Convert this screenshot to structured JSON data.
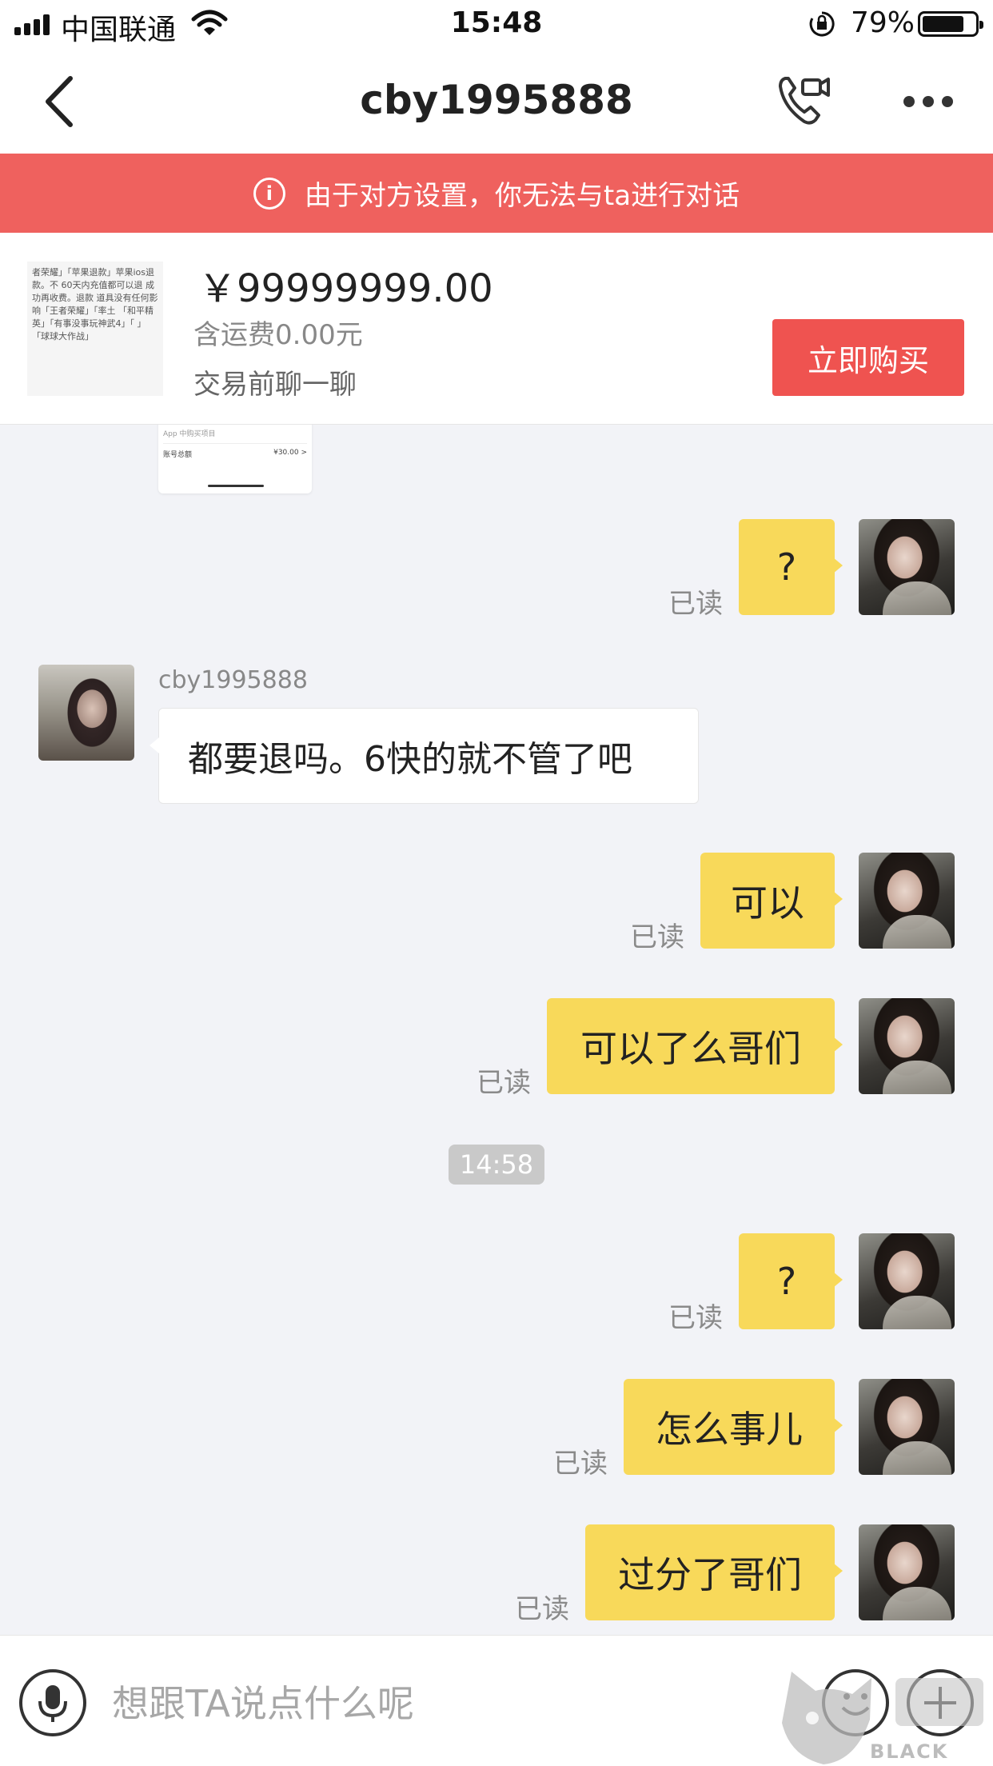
{
  "status_bar": {
    "carrier": "中国联通",
    "time": "15:48",
    "battery_percent": "79%",
    "battery_level": 0.79
  },
  "header": {
    "title": "cby1995888",
    "back_icon": "chevron-left-icon",
    "call_icon": "phone-video-icon",
    "more_icon": "more-dots-icon"
  },
  "banner": {
    "text": "由于对方设置，你无法与ta进行对话",
    "color": "#ef615e"
  },
  "product": {
    "thumb_text": "者荣耀」「苹果退款」苹果ios退款。不 60天内充值都可以退 成功再收费。退款 道具没有任何影响「王者荣耀」「率土 「和平精英」「有事没事玩神武4」「 」「球球大作战」",
    "price": "￥99999999.00",
    "shipping": "含运费0.00元",
    "hint": "交易前聊一聊",
    "buy_label": "立即购买",
    "buy_color": "#ef5350"
  },
  "partial_card": {
    "line1": "App 中购买项目",
    "label": "账号总额",
    "amount": "¥30.00 >"
  },
  "messages": {
    "m1": {
      "text": "?",
      "status": "已读"
    },
    "m2": {
      "sender": "cby1995888",
      "text": "都要退吗。6快的就不管了吧"
    },
    "m3": {
      "text": "可以",
      "status": "已读"
    },
    "m4": {
      "text": "可以了么哥们",
      "status": "已读"
    },
    "timestamp": "14:58",
    "m5": {
      "text": "?",
      "status": "已读"
    },
    "m6": {
      "text": "怎么事儿",
      "status": "已读"
    },
    "m7": {
      "text": "过分了哥们",
      "status": "已读"
    }
  },
  "input": {
    "placeholder": "想跟TA说点什么呢",
    "mic_icon": "microphone-icon",
    "emoji_icon": "emoji-icon",
    "plus_icon": "plus-icon"
  },
  "bubble_color": "#f8d95a",
  "watermark": {
    "text": "BLACK CAT"
  }
}
